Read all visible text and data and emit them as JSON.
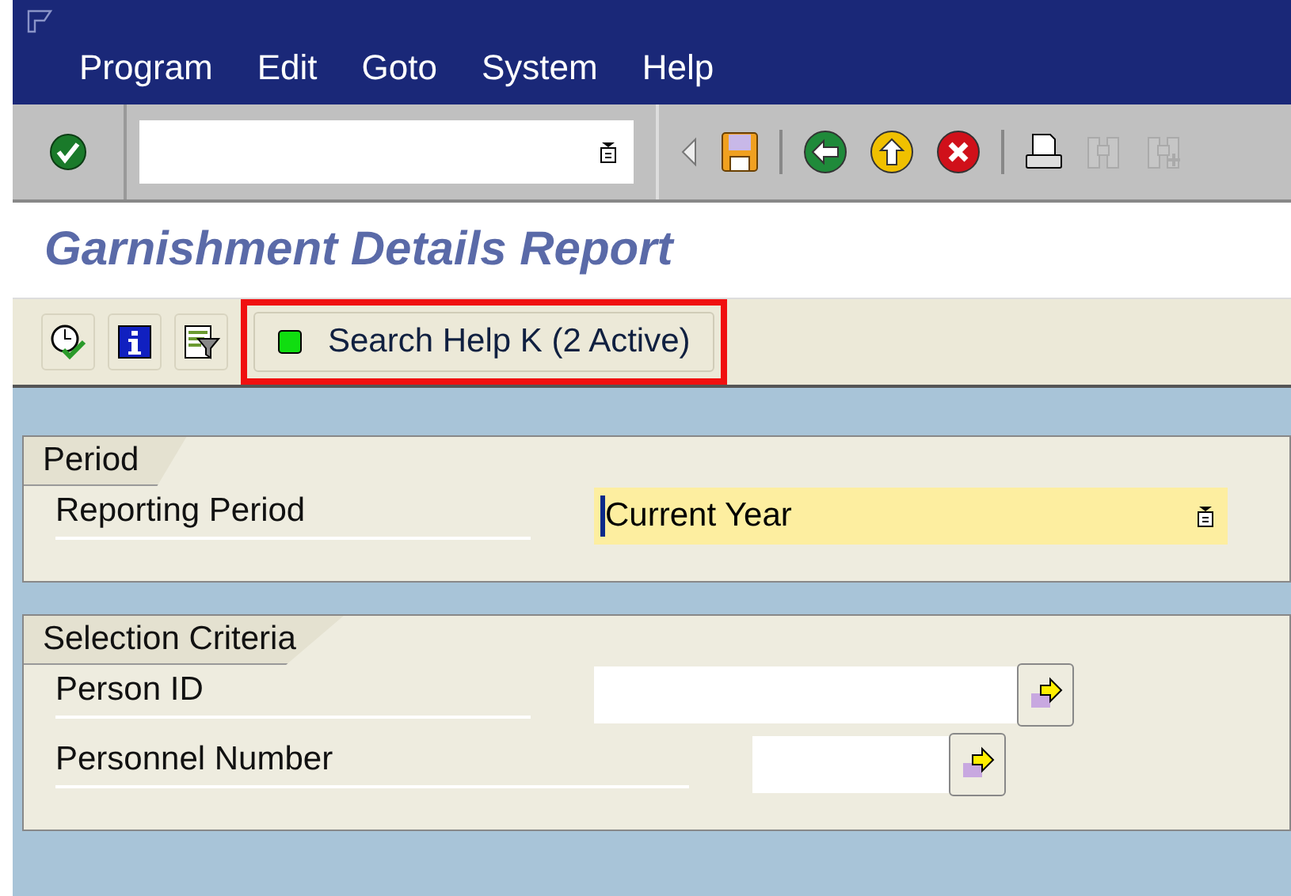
{
  "menu": [
    {
      "label": "Program"
    },
    {
      "label": "Edit"
    },
    {
      "label": "Goto"
    },
    {
      "label": "System"
    },
    {
      "label": "Help"
    }
  ],
  "toolbar": {
    "buttons": [
      {
        "kind": "back-arrow",
        "disabled": false
      },
      {
        "kind": "save",
        "disabled": false
      },
      {
        "kind": "sep"
      },
      {
        "kind": "back",
        "disabled": false
      },
      {
        "kind": "exit",
        "disabled": false
      },
      {
        "kind": "cancel",
        "disabled": false
      },
      {
        "kind": "sep"
      },
      {
        "kind": "print",
        "disabled": false
      },
      {
        "kind": "find",
        "disabled": true
      },
      {
        "kind": "find-next",
        "disabled": true
      }
    ]
  },
  "title": "Garnishment Details Report",
  "app_toolbar": {
    "icons": [
      {
        "kind": "execute"
      },
      {
        "kind": "info"
      },
      {
        "kind": "filter"
      }
    ],
    "search_help": {
      "label": "Search Help K (2 Active)",
      "highlighted": true
    }
  },
  "groups": [
    {
      "title": "Period",
      "fields": [
        {
          "label": "Reporting Period",
          "value": "Current Year",
          "focused": true,
          "kind": "long",
          "dropdown": true
        }
      ]
    },
    {
      "title": "Selection Criteria",
      "fields": [
        {
          "label": "Person ID",
          "focused": false,
          "kind": "long",
          "multiple": true
        },
        {
          "label": "Personnel Number",
          "focused": false,
          "kind": "short",
          "multiple": true
        }
      ]
    }
  ]
}
